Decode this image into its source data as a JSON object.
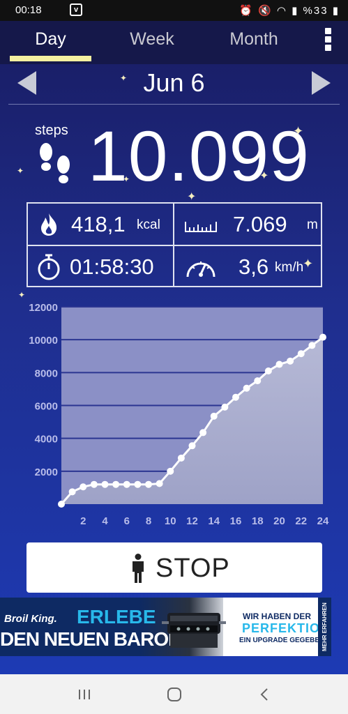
{
  "status_bar": {
    "time": "00:18",
    "notification_icon": "v-app-icon",
    "battery": "%33"
  },
  "tabs": [
    {
      "label": "Day",
      "active": true
    },
    {
      "label": "Week",
      "active": false
    },
    {
      "label": "Month",
      "active": false
    }
  ],
  "date": "Jun 6",
  "steps": {
    "label": "steps",
    "value": "10.099"
  },
  "stats": {
    "calories": {
      "value": "418,1",
      "unit": "kcal",
      "icon": "flame-icon"
    },
    "distance": {
      "value": "7.069",
      "unit": "m",
      "icon": "ruler-icon"
    },
    "duration": {
      "value": "01:58:30",
      "icon": "stopwatch-icon"
    },
    "speed": {
      "value": "3,6",
      "unit": "km/h",
      "icon": "speedometer-icon"
    }
  },
  "chart_data": {
    "type": "area",
    "x": [
      0,
      1,
      2,
      3,
      4,
      5,
      6,
      7,
      8,
      9,
      10,
      11,
      12,
      13,
      14,
      15,
      16,
      17,
      18,
      19,
      20,
      21,
      22,
      23,
      24
    ],
    "values": [
      0,
      750,
      1050,
      1200,
      1200,
      1200,
      1200,
      1200,
      1200,
      1250,
      2000,
      2800,
      3550,
      4350,
      5350,
      5900,
      6500,
      7050,
      7500,
      8100,
      8500,
      8700,
      9150,
      9650,
      10150
    ],
    "xticks": [
      "2",
      "4",
      "6",
      "8",
      "10",
      "12",
      "14",
      "16",
      "18",
      "20",
      "22",
      "24"
    ],
    "yticks": [
      "2000",
      "4000",
      "6000",
      "8000",
      "10000",
      "12000"
    ],
    "xlim": [
      0,
      24
    ],
    "ylim": [
      0,
      12000
    ],
    "grid": true,
    "colors": {
      "line": "#ffffff",
      "fill_top": "#b6b9d6",
      "fill_bottom": "#9ea2c7",
      "grid": "#2b3591",
      "tick_text": "#b9bdea",
      "plot_bg": "#8b90c6"
    }
  },
  "stop_button": {
    "label": "STOP",
    "icon": "person-icon"
  },
  "ad": {
    "brand": "Broil King.",
    "headline1": "ERLEBE",
    "headline2": "DEN NEUEN BARON.",
    "right1": "WIR HABEN DER",
    "right2": "PERFEKTION",
    "right3": "EIN UPGRADE GEGEBEN",
    "side": "MEHR ERFAHREN"
  },
  "nav": {
    "recents_icon": "recents-icon",
    "home_icon": "home-icon",
    "back_icon": "back-icon"
  }
}
